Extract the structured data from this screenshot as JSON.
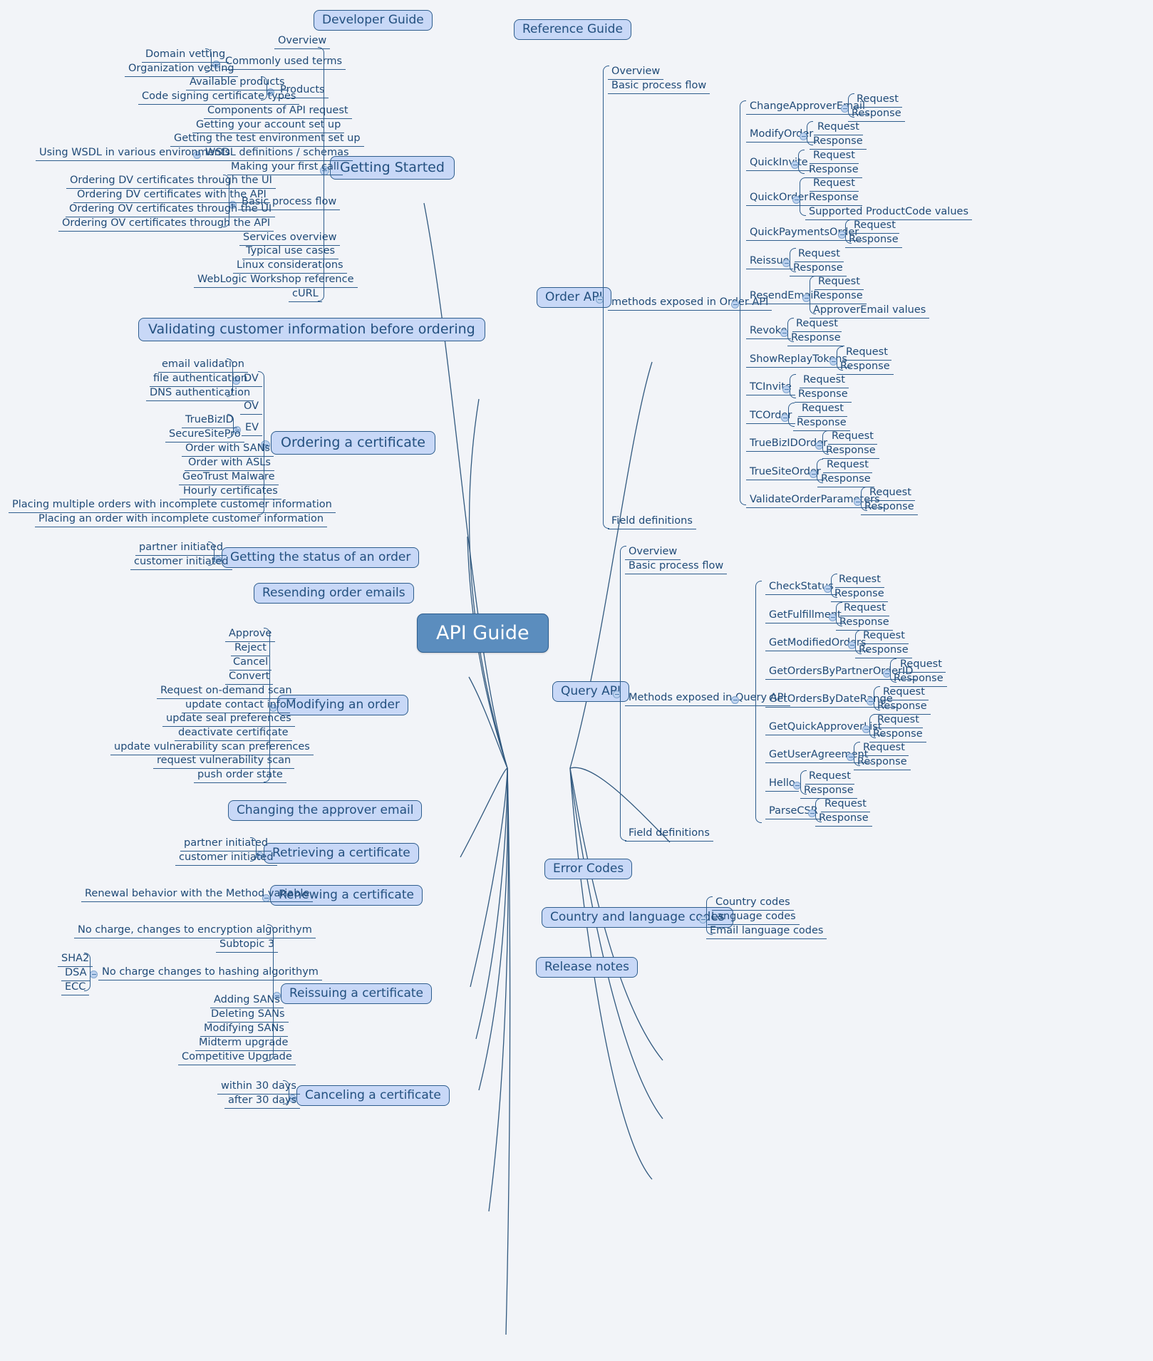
{
  "colors": {
    "background": "#f2f4f8",
    "root_fill": "#5b8dbe",
    "node_fill": "#c8d8f7",
    "stroke": "#2e5d8d",
    "text": "#1f4a77"
  },
  "root": {
    "label": "API Guide"
  },
  "guides": {
    "developer": "Developer Guide",
    "reference": "Reference Guide"
  },
  "branches": {
    "getting_started": {
      "label": "Getting Started",
      "children": [
        "Overview",
        "Commonly used terms",
        "Products",
        "Components of API request",
        "Getting your account set up",
        "Getting the test environment set up",
        "WSDL definitions / schemas",
        "Making your first call",
        "Basic process flow",
        "Services overview",
        "Typical use cases",
        "Linux considerations",
        "WebLogic Workshop reference",
        "cURL"
      ],
      "commonly_used_terms": [
        "Domain vetting",
        "Organization vetting"
      ],
      "products": [
        "Available products",
        "Code signing certificate types"
      ],
      "wsdl": [
        "Using WSDL in various environments"
      ],
      "basic_process_flow": [
        "Ordering DV certificates through the UI",
        "Ordering DV certificates with the API",
        "Ordering OV certificates through the UI",
        "Ordering OV certificates through the API"
      ]
    },
    "validating": {
      "label": "Validating customer information before ordering"
    },
    "ordering": {
      "label": "Ordering a certificate",
      "children": [
        "DV",
        "OV",
        "EV",
        "Order with SANs",
        "Order with ASLs",
        "GeoTrust Malware",
        "Hourly certificates",
        "Placing multiple orders with incomplete customer information",
        "Placing an order with incomplete customer information"
      ],
      "dv": [
        "email validation",
        "file authentication",
        "DNS authentication"
      ],
      "ev": [
        "TrueBizID",
        "SecureSitePro"
      ]
    },
    "order_status": {
      "label": "Getting the status of an order",
      "children": [
        "partner initiated",
        "customer initiated"
      ]
    },
    "resending": {
      "label": "Resending order emails"
    },
    "modifying": {
      "label": "Modifying an order",
      "children": [
        "Approve",
        "Reject",
        "Cancel",
        "Convert",
        "Request on-demand scan",
        "update contact info",
        "update seal preferences",
        "deactivate certificate",
        "update vulnerability scan preferences",
        "request vulnerability scan",
        "push order state"
      ]
    },
    "changing_approver": {
      "label": "Changing the approver email"
    },
    "retrieving": {
      "label": "Retrieving a certificate",
      "children": [
        "partner initiated",
        "customer initiated"
      ]
    },
    "renewing": {
      "label": "Renewing a certificate",
      "children": [
        "Renewal behavior with the Method variable"
      ]
    },
    "reissuing": {
      "label": "Reissuing a certificate",
      "children": [
        "No charge, changes to encryption algorithym",
        "Subtopic 3",
        "No charge changes to hashing algorithym",
        "Adding SANs",
        "Deleting SANs",
        "Modifying SANs",
        "Midterm upgrade",
        "Competitive Upgrade"
      ],
      "hashing": [
        "SHA2",
        "DSA",
        "ECC"
      ]
    },
    "canceling": {
      "label": "Canceling a certificate",
      "children": [
        "within 30 days",
        "after 30 days"
      ]
    },
    "order_api": {
      "label": "Order API",
      "children": [
        "Overview",
        "Basic process flow",
        "methods exposed in Order API",
        "Field definitions"
      ],
      "methods_label": "methods exposed in Order API",
      "methods": [
        {
          "name": "ChangeApproverEmail",
          "ops": [
            "Request",
            "Response"
          ]
        },
        {
          "name": "ModifyOrder",
          "ops": [
            "Request",
            "Response"
          ]
        },
        {
          "name": "QuickInvite",
          "ops": [
            "Request",
            "Response"
          ]
        },
        {
          "name": "QuickOrder",
          "ops": [
            "Request",
            "Response",
            "Supported ProductCode values"
          ]
        },
        {
          "name": "QuickPaymentsOrder",
          "ops": [
            "Request",
            "Response"
          ]
        },
        {
          "name": "Reissue",
          "ops": [
            "Request",
            "Response"
          ]
        },
        {
          "name": "ResendEmail",
          "ops": [
            "Request",
            "Response",
            "ApproverEmail values"
          ]
        },
        {
          "name": "Revoke",
          "ops": [
            "Request",
            "Response"
          ]
        },
        {
          "name": "ShowReplayTokens",
          "ops": [
            "Request",
            "Response"
          ]
        },
        {
          "name": "TCInvite",
          "ops": [
            "Request",
            "Response"
          ]
        },
        {
          "name": "TCOrder",
          "ops": [
            "Request",
            "Response"
          ]
        },
        {
          "name": "TrueBizIDOrder",
          "ops": [
            "Request",
            "Response"
          ]
        },
        {
          "name": "TrueSiteOrder",
          "ops": [
            "Request",
            "Response"
          ]
        },
        {
          "name": "ValidateOrderParameters",
          "ops": [
            "Request",
            "Response"
          ]
        }
      ]
    },
    "query_api": {
      "label": "Query API",
      "children": [
        "Overview",
        "Basic process flow",
        "Methods exposed in Query API",
        "Field definitions"
      ],
      "methods_label": "Methods exposed in Query API",
      "methods": [
        {
          "name": "CheckStatus",
          "ops": [
            "Request",
            "Response"
          ]
        },
        {
          "name": "GetFulfillment",
          "ops": [
            "Request",
            "Response"
          ]
        },
        {
          "name": "GetModifiedOrders",
          "ops": [
            "Request",
            "Response"
          ]
        },
        {
          "name": "GetOrdersByPartnerOrderID",
          "ops": [
            "Request",
            "Response"
          ]
        },
        {
          "name": "GetOrdersByDateRange",
          "ops": [
            "Request",
            "Response"
          ]
        },
        {
          "name": "GetQuickApproverList",
          "ops": [
            "Request",
            "Response"
          ]
        },
        {
          "name": "GetUserAgreement",
          "ops": [
            "Request",
            "Response"
          ]
        },
        {
          "name": "Hello",
          "ops": [
            "Request",
            "Response"
          ]
        },
        {
          "name": "ParseCSR",
          "ops": [
            "Request",
            "Response"
          ]
        }
      ]
    },
    "error_codes": {
      "label": "Error Codes"
    },
    "country_lang": {
      "label": "Country and language codes",
      "children": [
        "Country codes",
        "Language codes",
        "Email language codes"
      ]
    },
    "release_notes": {
      "label": "Release notes"
    }
  }
}
